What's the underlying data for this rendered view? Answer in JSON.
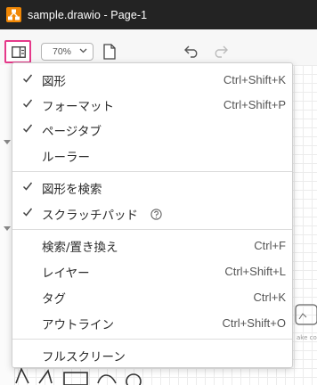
{
  "window": {
    "title": "sample.drawio - Page-1"
  },
  "toolbar": {
    "zoom": "70%"
  },
  "menu": {
    "items": [
      {
        "label": "図形",
        "shortcut": "Ctrl+Shift+K",
        "checked": true
      },
      {
        "label": "フォーマット",
        "shortcut": "Ctrl+Shift+P",
        "checked": true
      },
      {
        "label": "ページタブ",
        "shortcut": "",
        "checked": true
      },
      {
        "label": "ルーラー",
        "shortcut": "",
        "checked": false
      },
      {
        "label": "図形を検索",
        "shortcut": "",
        "checked": true
      },
      {
        "label": "スクラッチパッド",
        "shortcut": "",
        "checked": true,
        "help": true
      },
      {
        "label": "検索/置き換え",
        "shortcut": "Ctrl+F",
        "checked": false
      },
      {
        "label": "レイヤー",
        "shortcut": "Ctrl+Shift+L",
        "checked": false
      },
      {
        "label": "タグ",
        "shortcut": "Ctrl+K",
        "checked": false
      },
      {
        "label": "アウトライン",
        "shortcut": "Ctrl+Shift+O",
        "checked": false
      },
      {
        "label": "フルスクリーン",
        "shortcut": "",
        "checked": false
      }
    ]
  },
  "canvas": {
    "caption": "ake co"
  },
  "colors": {
    "titlebar": "#232323",
    "app_icon": "#f08705",
    "highlight_border": "#e5398a"
  },
  "icons": {
    "app": "drawio-logo-icon",
    "format_panel": "format-panel-icon",
    "page": "page-icon",
    "undo": "undo-icon",
    "redo": "redo-icon",
    "check": "check-icon",
    "help": "help-icon"
  }
}
